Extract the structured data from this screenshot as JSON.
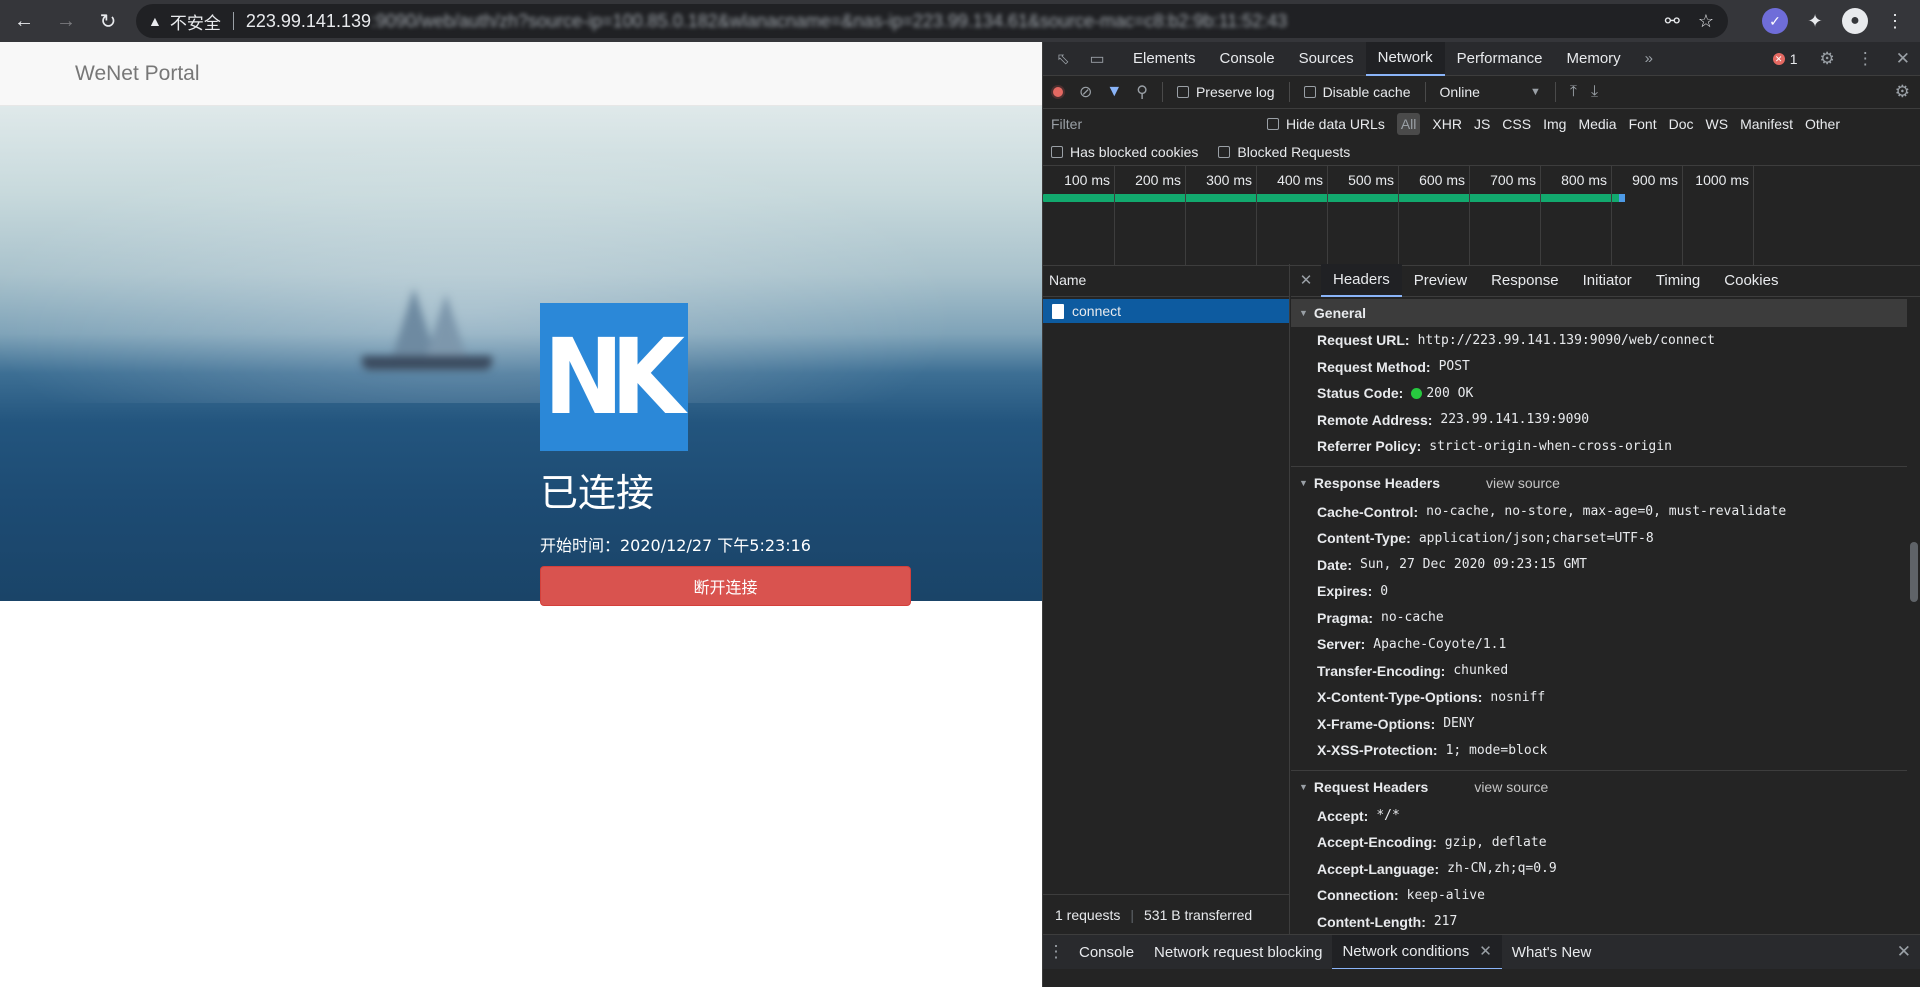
{
  "browser": {
    "security_label": "不安全",
    "url_host": "223.99.141.139",
    "url_rest": ":9090/web/auth/zh?source-ip=100.85.0.182&wlanacname=&nas-ip=223.99.134.61&source-mac=c8:b2:9b:11:52:43"
  },
  "page": {
    "brand": "WeNet Portal",
    "logo_text": "NK",
    "status_title": "已连接",
    "start_time": "开始时间：2020/12/27 下午5:23:16",
    "disconnect_label": "断开连接",
    "colors": {
      "logo": "#2b88d8",
      "disconnect": "#d9534f"
    }
  },
  "devtools": {
    "tabs": [
      "Elements",
      "Console",
      "Sources",
      "Network",
      "Performance",
      "Memory"
    ],
    "active_tab": "Network",
    "error_count": "1",
    "toolbar": {
      "preserve_log": "Preserve log",
      "disable_cache": "Disable cache",
      "throttle": "Online"
    },
    "filter": {
      "placeholder": "Filter",
      "hide_data_urls": "Hide data URLs",
      "types": [
        "All",
        "XHR",
        "JS",
        "CSS",
        "Img",
        "Media",
        "Font",
        "Doc",
        "WS",
        "Manifest",
        "Other"
      ],
      "has_blocked_cookies": "Has blocked cookies",
      "blocked_requests": "Blocked Requests"
    },
    "timeline": {
      "ticks": [
        "100 ms",
        "200 ms",
        "300 ms",
        "400 ms",
        "500 ms",
        "600 ms",
        "700 ms",
        "800 ms",
        "900 ms",
        "1000 ms"
      ],
      "request_end_ms": 820
    },
    "name_header": "Name",
    "requests": [
      "connect"
    ],
    "summary": {
      "requests": "1 requests",
      "transferred": "531 B transferred"
    },
    "detail_tabs": [
      "Headers",
      "Preview",
      "Response",
      "Initiator",
      "Timing",
      "Cookies"
    ],
    "general": {
      "title": "General",
      "rows": [
        {
          "k": "Request URL:",
          "v": "http://223.99.141.139:9090/web/connect"
        },
        {
          "k": "Request Method:",
          "v": "POST"
        },
        {
          "k": "Status Code:",
          "v": "200 OK"
        },
        {
          "k": "Remote Address:",
          "v": "223.99.141.139:9090"
        },
        {
          "k": "Referrer Policy:",
          "v": "strict-origin-when-cross-origin"
        }
      ]
    },
    "response_headers": {
      "title": "Response Headers",
      "view_source": "view source",
      "rows": [
        {
          "k": "Cache-Control:",
          "v": "no-cache, no-store, max-age=0, must-revalidate"
        },
        {
          "k": "Content-Type:",
          "v": "application/json;charset=UTF-8"
        },
        {
          "k": "Date:",
          "v": "Sun, 27 Dec 2020 09:23:15 GMT"
        },
        {
          "k": "Expires:",
          "v": "0"
        },
        {
          "k": "Pragma:",
          "v": "no-cache"
        },
        {
          "k": "Server:",
          "v": "Apache-Coyote/1.1"
        },
        {
          "k": "Transfer-Encoding:",
          "v": "chunked"
        },
        {
          "k": "X-Content-Type-Options:",
          "v": "nosniff"
        },
        {
          "k": "X-Frame-Options:",
          "v": "DENY"
        },
        {
          "k": "X-XSS-Protection:",
          "v": "1; mode=block"
        }
      ]
    },
    "request_headers": {
      "title": "Request Headers",
      "view_source": "view source",
      "rows": [
        {
          "k": "Accept:",
          "v": "*/*"
        },
        {
          "k": "Accept-Encoding:",
          "v": "gzip, deflate"
        },
        {
          "k": "Accept-Language:",
          "v": "zh-CN,zh;q=0.9"
        },
        {
          "k": "Connection:",
          "v": "keep-alive"
        },
        {
          "k": "Content-Length:",
          "v": "217"
        }
      ]
    },
    "drawer": {
      "tabs": [
        "Console",
        "Network request blocking",
        "Network conditions",
        "What's New"
      ],
      "active": "Network conditions"
    }
  }
}
